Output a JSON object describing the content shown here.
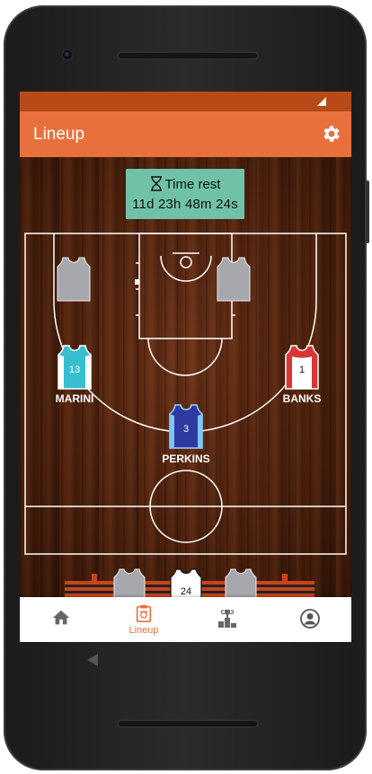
{
  "appbar": {
    "title": "Lineup"
  },
  "timer": {
    "label": "Time rest",
    "countdown": "11d 23h 48m 24s"
  },
  "court_players": [
    {
      "name": "",
      "number": "",
      "color": "#9ea0a6"
    },
    {
      "name": "",
      "number": "",
      "color": "#9ea0a6"
    },
    {
      "name": "MARINI",
      "number": "13",
      "color": "#37bfd0"
    },
    {
      "name": "BANKS",
      "number": "1",
      "color": "#d93535"
    },
    {
      "name": "PERKINS",
      "number": "3",
      "color": "#2e3aa0"
    }
  ],
  "bench": {
    "visible_number": "24"
  },
  "nav": {
    "home": {
      "label": ""
    },
    "lineup": {
      "label": "Lineup"
    },
    "ranking": {
      "label": ""
    },
    "profile": {
      "label": ""
    }
  },
  "colors": {
    "accent": "#e8703d",
    "statusbar": "#b84a17",
    "timer_bg": "#6fc2a8"
  }
}
